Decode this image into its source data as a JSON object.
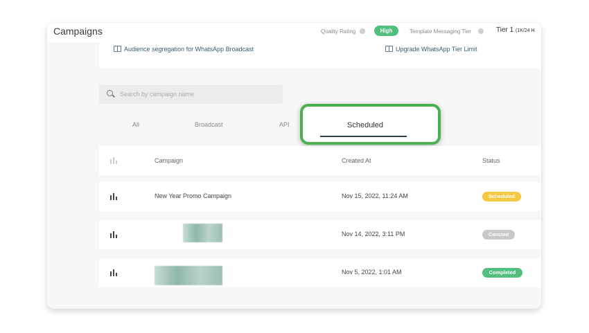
{
  "header": {
    "title": "Campaigns",
    "quality_rating_label": "Quality Rating",
    "quality_rating_value": "High",
    "tier_label": "Template Messaging Tier",
    "tier_value": "Tier 1",
    "tier_limit": "(1K/24 H"
  },
  "links": {
    "audience": "Audience segregation for WhatsApp Broadcast",
    "upgrade": "Upgrade WhatsApp Tier Limit"
  },
  "search": {
    "placeholder": "Search by campaign name",
    "value": ""
  },
  "tabs": [
    {
      "label": "All"
    },
    {
      "label": "Broadcast"
    },
    {
      "label": "API"
    },
    {
      "label": "Scheduled",
      "active": true
    }
  ],
  "table": {
    "columns": [
      "Campaign",
      "Created At",
      "Status"
    ],
    "rows": [
      {
        "campaign": "New Year Promo Campaign",
        "created_at": "Nov 15, 2022, 11:24 AM",
        "status": "Scheduled",
        "status_color": "#f5c842"
      },
      {
        "campaign": "",
        "created_at": "Nov 14, 2022, 3:11 PM",
        "status": "Cancled",
        "status_color": "#c8c8c8"
      },
      {
        "campaign": "",
        "created_at": "Nov 5, 2022, 1:01 AM",
        "status": "Completed",
        "status_color": "#52c07d"
      }
    ]
  },
  "colors": {
    "accent_green": "#4caf50",
    "high_pill": "#52c07d"
  }
}
